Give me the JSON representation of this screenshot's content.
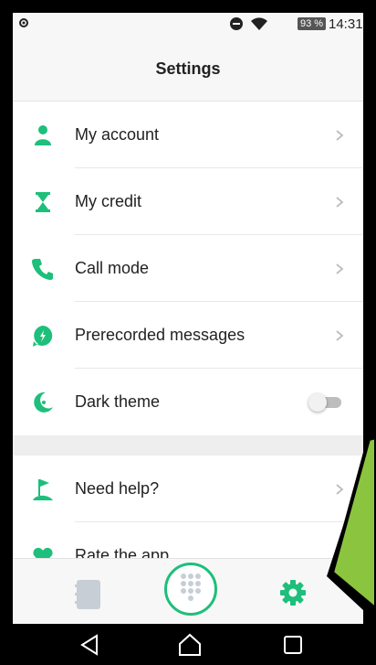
{
  "status_bar": {
    "battery": "93 %",
    "time": "14:31"
  },
  "header": {
    "title": "Settings"
  },
  "settings": {
    "items": [
      {
        "label": "My account",
        "icon": "person-icon"
      },
      {
        "label": "My credit",
        "icon": "hourglass-icon"
      },
      {
        "label": "Call mode",
        "icon": "phone-icon"
      },
      {
        "label": "Prerecorded messages",
        "icon": "message-bolt-icon"
      },
      {
        "label": "Dark theme",
        "icon": "moon-icon",
        "toggle": false
      }
    ],
    "items2": [
      {
        "label": "Need help?",
        "icon": "flag-icon"
      },
      {
        "label": "Rate the app",
        "icon": "heart-icon"
      }
    ]
  },
  "colors": {
    "accent": "#1dbf7a",
    "text": "#222222",
    "divider": "#e8e8e8",
    "overlay": "#8bc53f"
  },
  "bottom_nav": {
    "items": [
      "contacts-icon",
      "dialpad-icon",
      "settings-gear-icon"
    ],
    "active": "settings-gear-icon"
  }
}
